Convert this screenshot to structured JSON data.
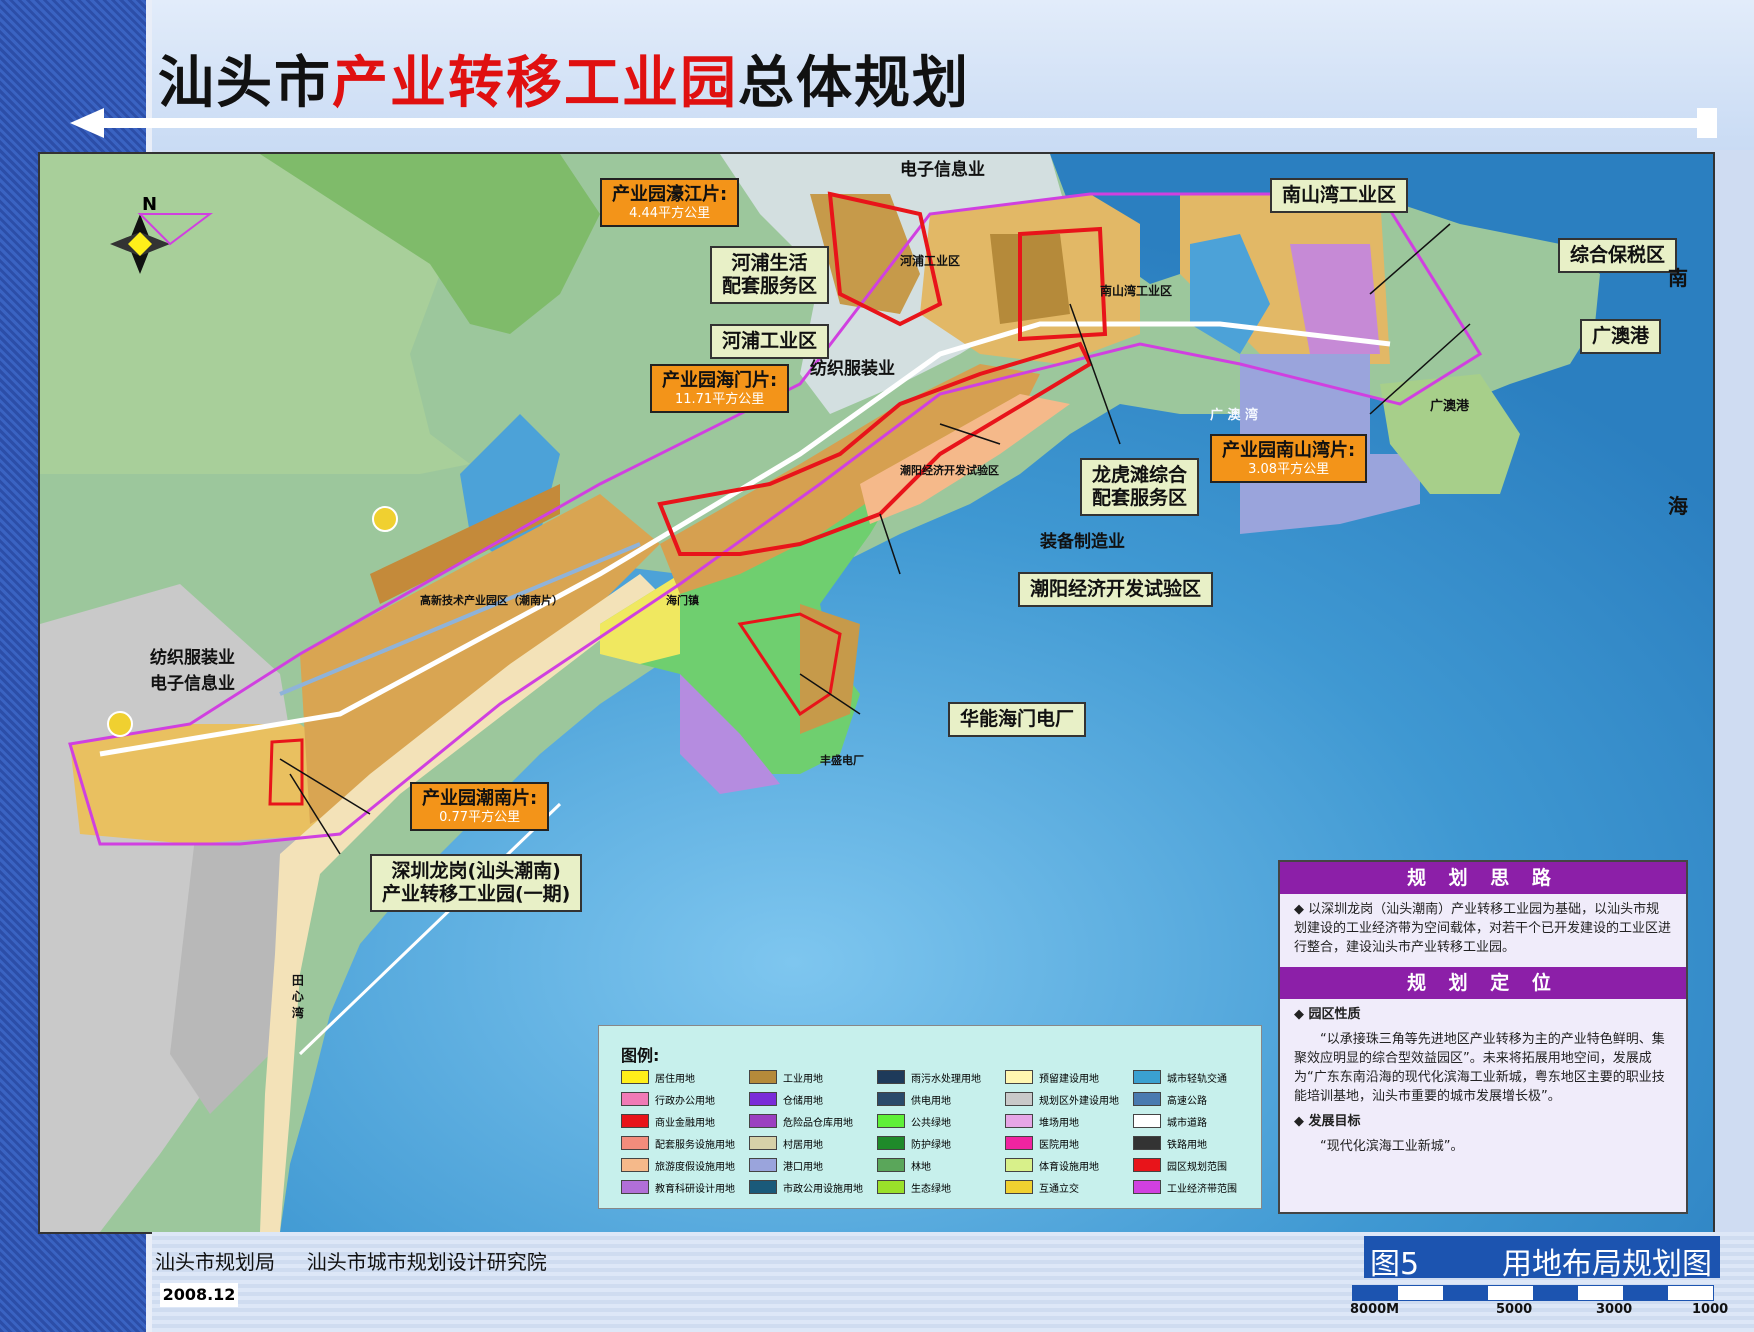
{
  "title": {
    "prefix": "汕头市",
    "highlight": "产业转移工业园",
    "suffix": "总体规划"
  },
  "north": "N",
  "map_labels": {
    "haojiang_park": "产业园濠江片:",
    "haojiang_area": "4.44平方公里",
    "electronics_top": "电子信息业",
    "hepu_living": "河浦生活\n配套服务区",
    "hepu_industrial": "河浦工业区",
    "hepu_inner": "河浦工业区",
    "nanshanwan_industrial": "南山湾工业区",
    "nanshanwan_inner": "南山湾工业区",
    "bonded_zone": "综合保税区",
    "guangao_port": "广澳港",
    "guangao_port_inner": "广澳港",
    "nan": "南",
    "hai": "海",
    "textile_mid": "纺织服装业",
    "haimen_park": "产业园海门片:",
    "haimen_area": "11.71平方公里",
    "nanshanwan_park": "产业园南山湾片:",
    "nanshanwan_area": "3.08平方公里",
    "longhutan": "龙虎滩综合\n配套服务区",
    "equipment": "装备制造业",
    "chaoyang_zone": "潮阳经济开发试验区",
    "chaoyang_inner": "潮阳经济开发试验区",
    "huaneng": "华能海门电厂",
    "textile_left": "纺织服装业",
    "electronics_left": "电子信息业",
    "chaonan_park": "产业园潮南片:",
    "chaonan_area": "0.77平方公里",
    "shenzhen_park": "深圳龙岗(汕头潮南)\n产业转移工业园(一期)",
    "guangao_bay": "广 澳 湾",
    "haimen_town": "海门镇",
    "hightech": "高新技术产业园区（潮南片）",
    "tianxin_bay": "田 心 湾",
    "fengsheng": "丰盛电厂"
  },
  "planning_idea": {
    "heading": "规 划 思 路",
    "text": "以深圳龙岗（汕头潮南）产业转移工业园为基础，以汕头市规划建设的工业经济带为空间载体，对若干个已开发建设的工业区进行整合，建设汕头市产业转移工业园。"
  },
  "planning_position": {
    "heading": "规 划 定 位",
    "nature_title": "园区性质",
    "nature_text": "“以承接珠三角等先进地区产业转移为主的产业特色鲜明、集聚效应明显的综合型效益园区”。未来将拓展用地空间，发展成为“广东东南沿海的现代化滨海工业新城，粤东地区主要的职业技能培训基地，汕头市重要的城市发展增长极”。",
    "goal_title": "发展目标",
    "goal_text": "“现代化滨海工业新城”。"
  },
  "legend": {
    "title": "图例:",
    "items": [
      {
        "label": "居住用地",
        "color": "#ffef1a"
      },
      {
        "label": "行政办公用地",
        "color": "#f07ab6"
      },
      {
        "label": "商业金融用地",
        "color": "#e8141a"
      },
      {
        "label": "配套服务设施用地",
        "color": "#f28c7c"
      },
      {
        "label": "旅游度假设施用地",
        "color": "#f5b98a"
      },
      {
        "label": "教育科研设计用地",
        "color": "#b16fd8"
      },
      {
        "label": "工业用地",
        "color": "#b58a3a"
      },
      {
        "label": "仓储用地",
        "color": "#7a2bd8"
      },
      {
        "label": "危险品仓库用地",
        "color": "#9b3fc0"
      },
      {
        "label": "村居用地",
        "color": "#d6d1a8"
      },
      {
        "label": "港口用地",
        "color": "#9aa4dc"
      },
      {
        "label": "市政公用设施用地",
        "color": "#1a5a7a"
      },
      {
        "label": "雨污水处理用地",
        "color": "#1e3a5a"
      },
      {
        "label": "供电用地",
        "color": "#2a4a6a"
      },
      {
        "label": "公共绿地",
        "color": "#5ef038"
      },
      {
        "label": "防护绿地",
        "color": "#1f8a2a"
      },
      {
        "label": "林地",
        "color": "#5aa65a"
      },
      {
        "label": "生态绿地",
        "color": "#9ae02a"
      },
      {
        "label": "预留建设用地",
        "color": "#fff6b0"
      },
      {
        "label": "规划区外建设用地",
        "color": "#c9c9c9"
      },
      {
        "label": "堆场用地",
        "color": "#e6a6e6"
      },
      {
        "label": "医院用地",
        "color": "#f024a0"
      },
      {
        "label": "体育设施用地",
        "color": "#d8f08a"
      },
      {
        "label": "互通立交",
        "color": "#f0d030"
      },
      {
        "label": "城市轻轨交通",
        "color": "#3aa0d0"
      },
      {
        "label": "高速公路",
        "color": "#4a7ab0"
      },
      {
        "label": "城市道路",
        "color": "#ffffff"
      },
      {
        "label": "铁路用地",
        "color": "#333333"
      },
      {
        "label": "园区规划范围",
        "color": "#e8141a"
      },
      {
        "label": "工业经济带范围",
        "color": "#d040e0"
      }
    ]
  },
  "footer": {
    "org1": "汕头市规划局",
    "org2": "汕头市城市规划设计研究院",
    "date": "2008.12",
    "fig_no": "图5",
    "fig_name": "用地布局规划图",
    "scale_labels": [
      "8000M",
      "5000",
      "3000",
      "1000"
    ]
  },
  "colors": {
    "sea": "#4ca2d8",
    "land": "#9cc79c",
    "industry": "#c69a4a",
    "boundary": "#e8141a",
    "belt": "#d040e0",
    "panel_head": "#8c1fa8"
  }
}
